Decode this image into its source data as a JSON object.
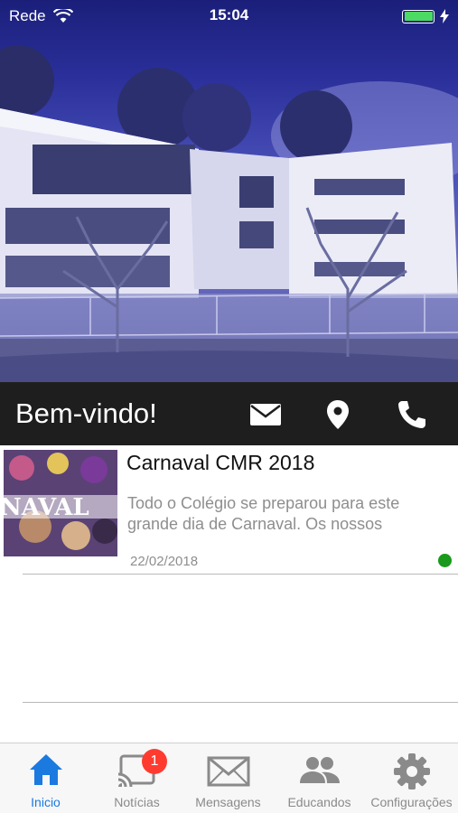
{
  "status_bar": {
    "carrier": "Rede",
    "time": "15:04"
  },
  "hero": {
    "icon": "school-building-image"
  },
  "welcome": {
    "title": "Bem-vindo!",
    "actions": [
      {
        "icon": "mail-icon"
      },
      {
        "icon": "location-pin-icon"
      },
      {
        "icon": "phone-icon"
      }
    ]
  },
  "news": [
    {
      "title": "Carnaval CMR 2018",
      "summary": "Todo o Colégio se preparou para este grande dia de Carnaval. Os nossos",
      "date": "22/02/2018",
      "status_color": "#1a9a1a"
    }
  ],
  "tab_bar": {
    "accent_color": "#1a7ae0",
    "tabs": [
      {
        "label": "Inicio",
        "icon": "home-icon",
        "active": true
      },
      {
        "label": "Notícias",
        "icon": "cast-icon",
        "badge": "1"
      },
      {
        "label": "Mensagens",
        "icon": "envelope-icon"
      },
      {
        "label": "Educandos",
        "icon": "people-icon"
      },
      {
        "label": "Configurações",
        "icon": "gear-icon"
      }
    ]
  }
}
